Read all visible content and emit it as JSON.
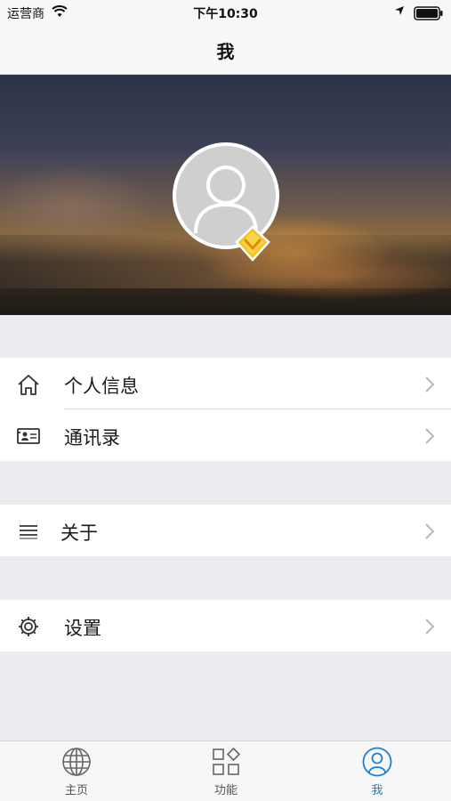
{
  "status_bar": {
    "carrier": "运营商",
    "time": "下午10:30"
  },
  "nav": {
    "title": "我"
  },
  "menu": {
    "group1": [
      {
        "label": "个人信息",
        "icon": "home-icon"
      },
      {
        "label": "通讯录",
        "icon": "contacts-card-icon"
      }
    ],
    "group2": [
      {
        "label": "关于",
        "icon": "menu-lines-icon"
      }
    ],
    "group3": [
      {
        "label": "设置",
        "icon": "gear-icon"
      }
    ]
  },
  "tabs": [
    {
      "label": "主页",
      "icon": "globe-icon",
      "active": false
    },
    {
      "label": "功能",
      "icon": "grid-shapes-icon",
      "active": false
    },
    {
      "label": "我",
      "icon": "person-circle-icon",
      "active": true
    }
  ],
  "colors": {
    "accent": "#1a7fd6",
    "background": "#ececf1",
    "badge": "#f5c518"
  }
}
